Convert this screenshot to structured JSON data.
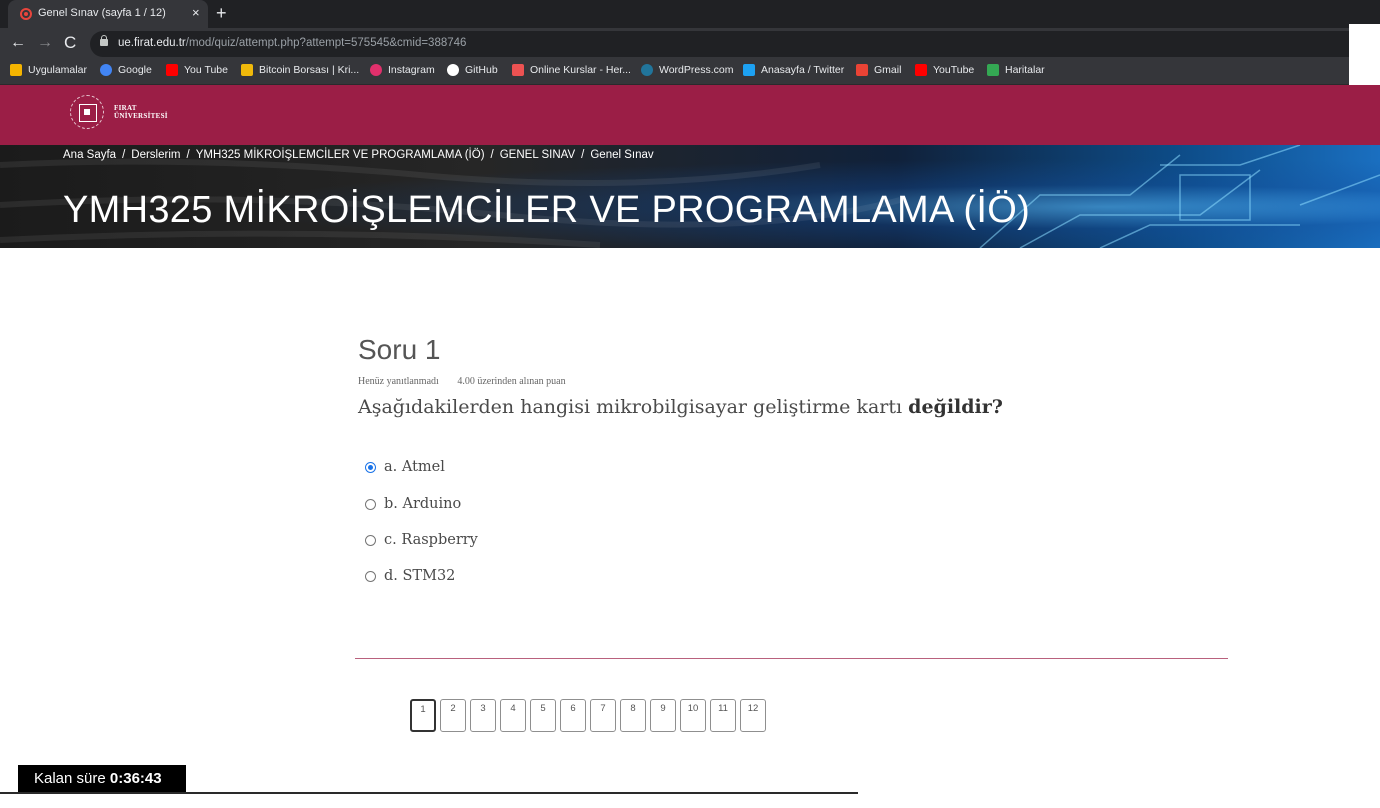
{
  "browser": {
    "tab_title": "Genel Sınav (sayfa 1 / 12)",
    "tab_close": "×",
    "new_tab": "+",
    "back": "←",
    "forward": "→",
    "reload": "C",
    "url_host": "ue.firat.edu.tr",
    "url_path": "/mod/quiz/attempt.php?attempt=575545&cmid=388746",
    "bookmarks": [
      {
        "label": "Uygulamalar",
        "icon": "apps-grid-icon",
        "color": "#f4b400"
      },
      {
        "label": "Google",
        "icon": "google-icon",
        "color": "#4285f4"
      },
      {
        "label": "You Tube",
        "icon": "youtube-icon",
        "color": "#ff0000"
      },
      {
        "label": "Bitcoin Borsası | Kri...",
        "icon": "binance-icon",
        "color": "#f0b90b"
      },
      {
        "label": "Instagram",
        "icon": "instagram-icon",
        "color": "#e1306c"
      },
      {
        "label": "GitHub",
        "icon": "github-icon",
        "color": "#ffffff"
      },
      {
        "label": "Online Kurslar - Her...",
        "icon": "udemy-icon",
        "color": "#ec5252"
      },
      {
        "label": "WordPress.com",
        "icon": "wordpress-icon",
        "color": "#21759b"
      },
      {
        "label": "Anasayfa / Twitter",
        "icon": "twitter-icon",
        "color": "#1da1f2"
      },
      {
        "label": "Gmail",
        "icon": "gmail-icon",
        "color": "#ea4335"
      },
      {
        "label": "YouTube",
        "icon": "youtube-icon",
        "color": "#ff0000"
      },
      {
        "label": "Haritalar",
        "icon": "maps-icon",
        "color": "#34a853"
      }
    ]
  },
  "site": {
    "logo_line1": "FIRAT",
    "logo_line2": "ÜNİVERSİTESİ",
    "brand_color": "#9b1e46"
  },
  "breadcrumb": [
    "Ana Sayfa",
    "Derslerim",
    "YMH325 MİKROİŞLEMCİLER VE PROGRAMLAMA (İÖ)",
    "GENEL SINAV",
    "Genel Sınav"
  ],
  "breadcrumb_separator": "/",
  "course_title": "YMH325 MİKROİŞLEMCİLER VE PROGRAMLAMA (İÖ)",
  "question": {
    "title": "Soru 1",
    "status": "Henüz yanıtlanmadı",
    "points": "4.00 üzerinden alınan puan",
    "text_prefix": "Aşağıdakilerden hangisi mikrobilgisayar geliştirme kartı",
    "text_bold": "değildir?",
    "answers": [
      {
        "label": "a. Atmel",
        "checked": true
      },
      {
        "label": "b. Arduino",
        "checked": false
      },
      {
        "label": "c. Raspberry",
        "checked": false
      },
      {
        "label": "d. STM32",
        "checked": false
      }
    ]
  },
  "quiz_nav": [
    "1",
    "2",
    "3",
    "4",
    "5",
    "6",
    "7",
    "8",
    "9",
    "10",
    "11",
    "12"
  ],
  "timer": {
    "label": "Kalan süre",
    "value": "0:36:43"
  }
}
